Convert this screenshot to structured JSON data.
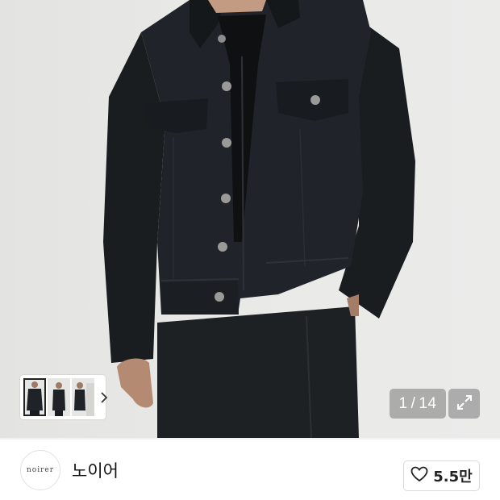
{
  "product_gallery": {
    "current_page": "1",
    "separator": "/",
    "total_pages": "14",
    "thumbnail_count": 3
  },
  "brand": {
    "logo_text": "noirer",
    "name": "노이어"
  },
  "like": {
    "count": "5.5만"
  },
  "colors": {
    "background": "#e9e9e7",
    "jacket": "#1c1f22",
    "overlay": "#787878"
  },
  "icons": [
    "chevron-right-icon",
    "expand-icon",
    "heart-icon"
  ]
}
